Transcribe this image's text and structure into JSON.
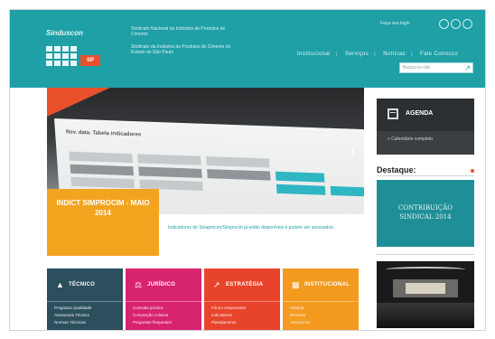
{
  "header": {
    "logo_text": "Sinduscon",
    "logo_badge": "SP",
    "org_line_1": "Sindicato Nacional da Indústria de Produtos de Cimento",
    "org_line_2": "Sindicato da Indústria de Produtos de Cimento do Estado de São Paulo",
    "sign_in_label": "Faça seu login",
    "nav_items": [
      "Institucional",
      "Serviços",
      "Notícias",
      "Fale Conosco"
    ],
    "search_placeholder": "Busca no site"
  },
  "hero": {
    "screen_title": "Rev. data. Tabela indicadores",
    "yellow_text": "INDICT SIMPROCIM - MAIO 2014",
    "caption": "Indicadores do Sinaprocim/Sinprocim já estão disponíveis e podem ser acessados."
  },
  "sidebar": {
    "agenda_title": "AGENDA",
    "agenda_link": "» Calendário completo",
    "destaque_title": "Destaque:",
    "banner_text": "CONTRIBUIÇÃO SINDICAL 2014"
  },
  "tiles": [
    {
      "title": "TÉCNICO",
      "icon": "chart-icon",
      "items": [
        "Programa Qualidade",
        "Assessoria Técnica",
        "Normas Técnicas"
      ]
    },
    {
      "title": "JURÍDICO",
      "icon": "scales-icon",
      "items": [
        "Consulta jurídica",
        "Convenção coletiva",
        "Perguntas frequentes"
      ]
    },
    {
      "title": "ESTRATÉGIA",
      "icon": "trend-icon",
      "items": [
        "Fórum empresarial",
        "Indicadores",
        "Planejamento"
      ]
    },
    {
      "title": "INSTITUCIONAL",
      "icon": "building-icon",
      "items": [
        "História",
        "Diretoria",
        "Associe-se"
      ]
    }
  ],
  "colors": {
    "header_teal": "#1f9fa6",
    "accent_orange": "#e8502c",
    "tile_tecnico": "#2c4f5e",
    "tile_juridico": "#d8236f",
    "tile_estrategia": "#e8442c",
    "tile_institucional": "#f39a1f"
  }
}
